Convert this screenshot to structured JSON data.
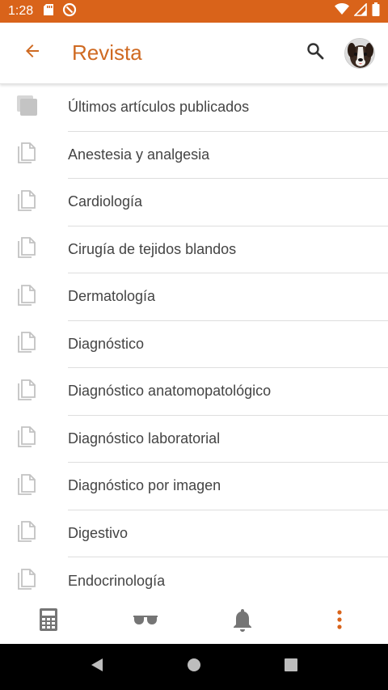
{
  "status_bar": {
    "time": "1:28",
    "background": "#d9631a"
  },
  "app_bar": {
    "title": "Revista",
    "title_color": "#cf6a22",
    "icons": [
      "arrow-back-icon",
      "search-icon",
      "avatar"
    ]
  },
  "list": {
    "items": [
      {
        "label": "Últimos artículos publicados",
        "icon": "copy-stack-icon"
      },
      {
        "label": "Anestesia y analgesia",
        "icon": "document-icon"
      },
      {
        "label": "Cardiología",
        "icon": "document-icon"
      },
      {
        "label": "Cirugía de tejidos blandos",
        "icon": "document-icon"
      },
      {
        "label": "Dermatología",
        "icon": "document-icon"
      },
      {
        "label": "Diagnóstico",
        "icon": "document-icon"
      },
      {
        "label": "Diagnóstico anatomopatológico",
        "icon": "document-icon"
      },
      {
        "label": "Diagnóstico laboratorial",
        "icon": "document-icon"
      },
      {
        "label": "Diagnóstico por imagen",
        "icon": "document-icon"
      },
      {
        "label": "Digestivo",
        "icon": "document-icon"
      },
      {
        "label": "Endocrinología",
        "icon": "document-icon"
      }
    ]
  },
  "bottom_nav": {
    "items": [
      "calculator-icon",
      "glasses-icon",
      "bell-icon",
      "more-vert-icon"
    ],
    "accent": "#d9631a"
  },
  "system_nav": {
    "items": [
      "back-triangle-icon",
      "home-circle-icon",
      "recents-square-icon"
    ]
  }
}
